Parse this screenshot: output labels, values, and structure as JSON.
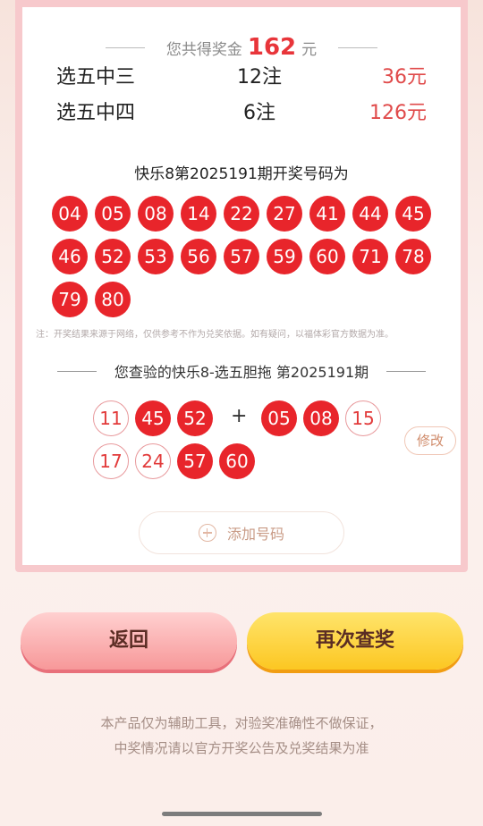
{
  "summary": {
    "label": "您共得奖金",
    "amount": "162",
    "unit": "元"
  },
  "prizes": [
    {
      "name": "选五中三",
      "count": "12注",
      "amount": "36元"
    },
    {
      "name": "选五中四",
      "count": "6注",
      "amount": "126元"
    }
  ],
  "draw": {
    "title": "快乐8第2025191期开奖号码为",
    "numbers": [
      "04",
      "05",
      "08",
      "14",
      "22",
      "27",
      "41",
      "44",
      "45",
      "46",
      "52",
      "53",
      "56",
      "57",
      "59",
      "60",
      "71",
      "78",
      "79",
      "80"
    ]
  },
  "note": "注：开奖结果来源于网络，仅供参考不作为兑奖依据。如有疑问，以福体彩官方数据为准。",
  "check": {
    "title": "您查验的快乐8-选五胆拖 第2025191期",
    "plus": "+",
    "row1": [
      {
        "num": "11",
        "hit": false
      },
      {
        "num": "45",
        "hit": true
      },
      {
        "num": "52",
        "hit": true
      },
      {
        "num": "05",
        "hit": true
      },
      {
        "num": "08",
        "hit": true
      },
      {
        "num": "15",
        "hit": false
      }
    ],
    "row2": [
      {
        "num": "17",
        "hit": false
      },
      {
        "num": "24",
        "hit": false
      },
      {
        "num": "57",
        "hit": true
      },
      {
        "num": "60",
        "hit": true
      }
    ],
    "modify_label": "修改"
  },
  "add_label": "添加号码",
  "buttons": {
    "back": "返回",
    "recheck": "再次查奖"
  },
  "disclaimer": {
    "line1": "本产品仅为辅助工具，对验奖准确性不做保证，",
    "line2": "中奖情况请以官方开奖公告及兑奖结果为准"
  },
  "colors": {
    "ball_red": "#e8252b",
    "amount_red": "#e04a4a",
    "back_button": "#f79899",
    "recheck_button": "#fcc722"
  }
}
